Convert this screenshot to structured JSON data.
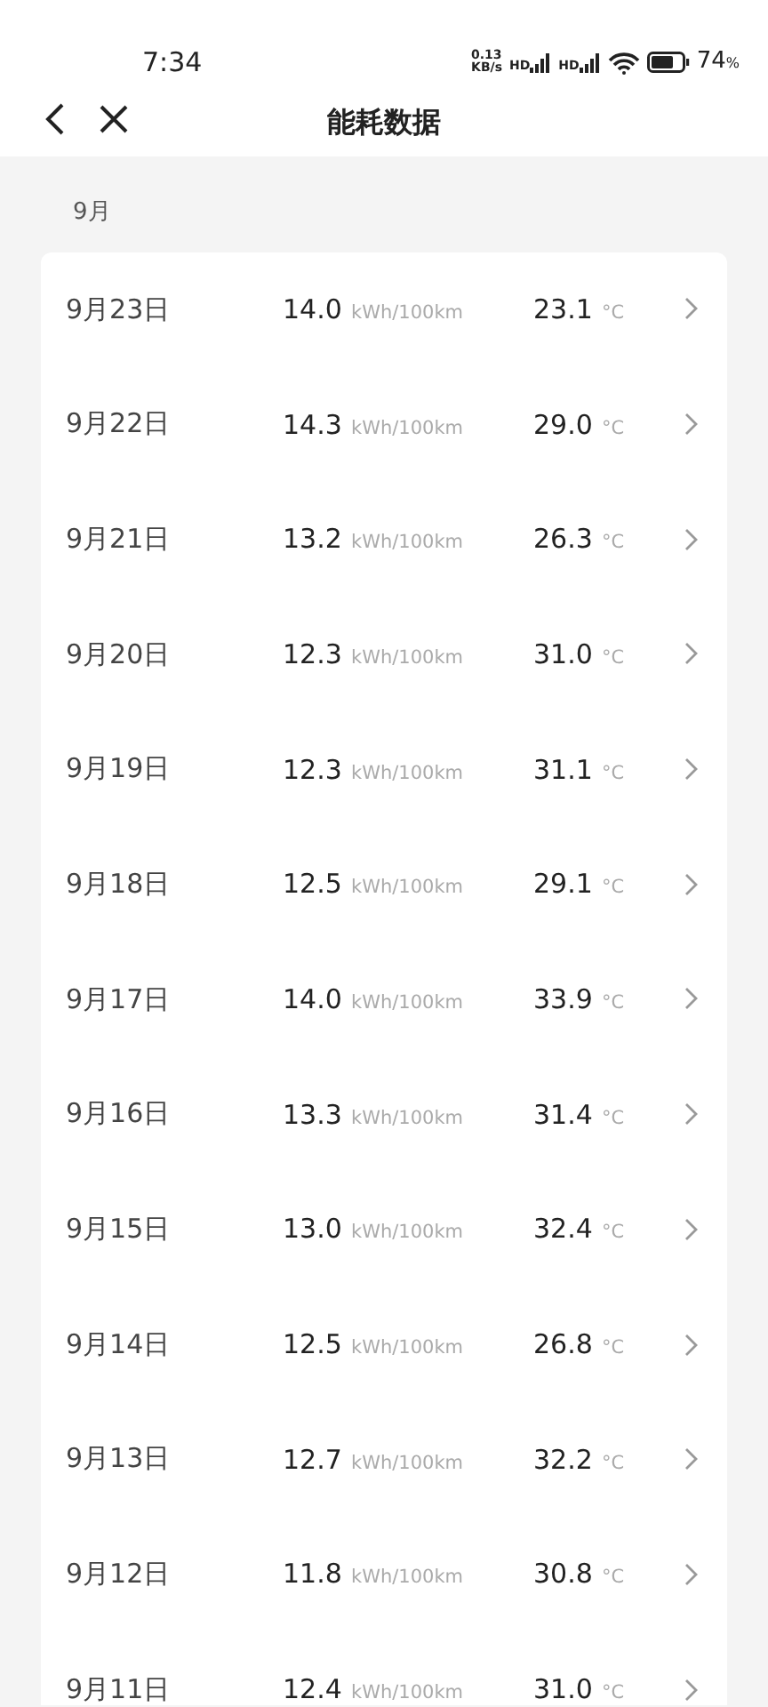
{
  "status_bar": {
    "time": "7:34",
    "net_speed": "0.13",
    "net_unit": "KB/s",
    "signal_labels": [
      "HD",
      "HD"
    ],
    "battery_text": "74",
    "battery_unit": "%"
  },
  "header": {
    "title": "能耗数据"
  },
  "month": "9月",
  "rows": [
    {
      "date": "9月23日",
      "energy": "14.0",
      "energy_unit": "kWh/100km",
      "temp": "23.1",
      "temp_unit": "°C"
    },
    {
      "date": "9月22日",
      "energy": "14.3",
      "energy_unit": "kWh/100km",
      "temp": "29.0",
      "temp_unit": "°C"
    },
    {
      "date": "9月21日",
      "energy": "13.2",
      "energy_unit": "kWh/100km",
      "temp": "26.3",
      "temp_unit": "°C"
    },
    {
      "date": "9月20日",
      "energy": "12.3",
      "energy_unit": "kWh/100km",
      "temp": "31.0",
      "temp_unit": "°C"
    },
    {
      "date": "9月19日",
      "energy": "12.3",
      "energy_unit": "kWh/100km",
      "temp": "31.1",
      "temp_unit": "°C"
    },
    {
      "date": "9月18日",
      "energy": "12.5",
      "energy_unit": "kWh/100km",
      "temp": "29.1",
      "temp_unit": "°C"
    },
    {
      "date": "9月17日",
      "energy": "14.0",
      "energy_unit": "kWh/100km",
      "temp": "33.9",
      "temp_unit": "°C"
    },
    {
      "date": "9月16日",
      "energy": "13.3",
      "energy_unit": "kWh/100km",
      "temp": "31.4",
      "temp_unit": "°C"
    },
    {
      "date": "9月15日",
      "energy": "13.0",
      "energy_unit": "kWh/100km",
      "temp": "32.4",
      "temp_unit": "°C"
    },
    {
      "date": "9月14日",
      "energy": "12.5",
      "energy_unit": "kWh/100km",
      "temp": "26.8",
      "temp_unit": "°C"
    },
    {
      "date": "9月13日",
      "energy": "12.7",
      "energy_unit": "kWh/100km",
      "temp": "32.2",
      "temp_unit": "°C"
    },
    {
      "date": "9月12日",
      "energy": "11.8",
      "energy_unit": "kWh/100km",
      "temp": "30.8",
      "temp_unit": "°C"
    },
    {
      "date": "9月11日",
      "energy": "12.4",
      "energy_unit": "kWh/100km",
      "temp": "31.0",
      "temp_unit": "°C"
    }
  ]
}
